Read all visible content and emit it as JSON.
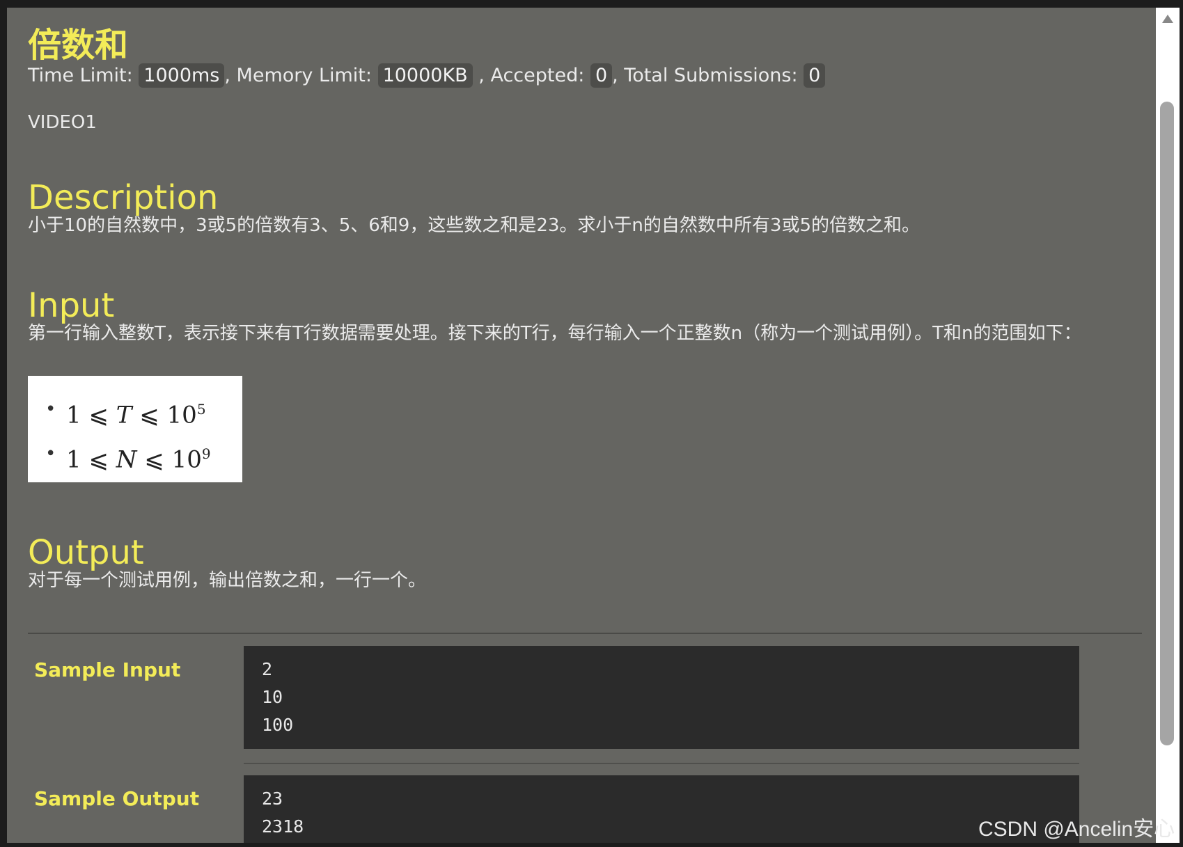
{
  "problem": {
    "title": "倍数和",
    "meta": {
      "time_label": "Time Limit:",
      "time_value": "1000ms",
      "memory_label": ", Memory Limit:",
      "memory_value": "10000KB",
      "accepted_label": ", Accepted:",
      "accepted_value": "0",
      "total_label": ", Total Submissions:",
      "total_value": "0"
    },
    "source": "VIDEO1"
  },
  "description": {
    "heading": "Description",
    "text": "小于10的自然数中，3或5的倍数有3、5、6和9，这些数之和是23。求小于n的自然数中所有3或5的倍数之和。"
  },
  "input": {
    "heading": "Input",
    "text": "第一行输入整数T，表示接下来有T行数据需要处理。接下来的T行，每行输入一个正整数n（称为一个测试用例）。T和n的范围如下：",
    "constraints": [
      {
        "bullet": "•",
        "lhs": "1 ⩽ ",
        "var": "T",
        "rhs": " ⩽ 10",
        "exp": "5"
      },
      {
        "bullet": "•",
        "lhs": "1 ⩽ ",
        "var": "N",
        "rhs": " ⩽ 10",
        "exp": "9"
      }
    ]
  },
  "output": {
    "heading": "Output",
    "text": "对于每一个测试用例，输出倍数之和，一行一个。"
  },
  "samples": {
    "input_label": "Sample Input",
    "input_lines": [
      "2",
      "10",
      "100"
    ],
    "output_label": "Sample Output",
    "output_lines": [
      "23",
      "2318"
    ]
  },
  "watermark": "CSDN @Ancelin安心"
}
